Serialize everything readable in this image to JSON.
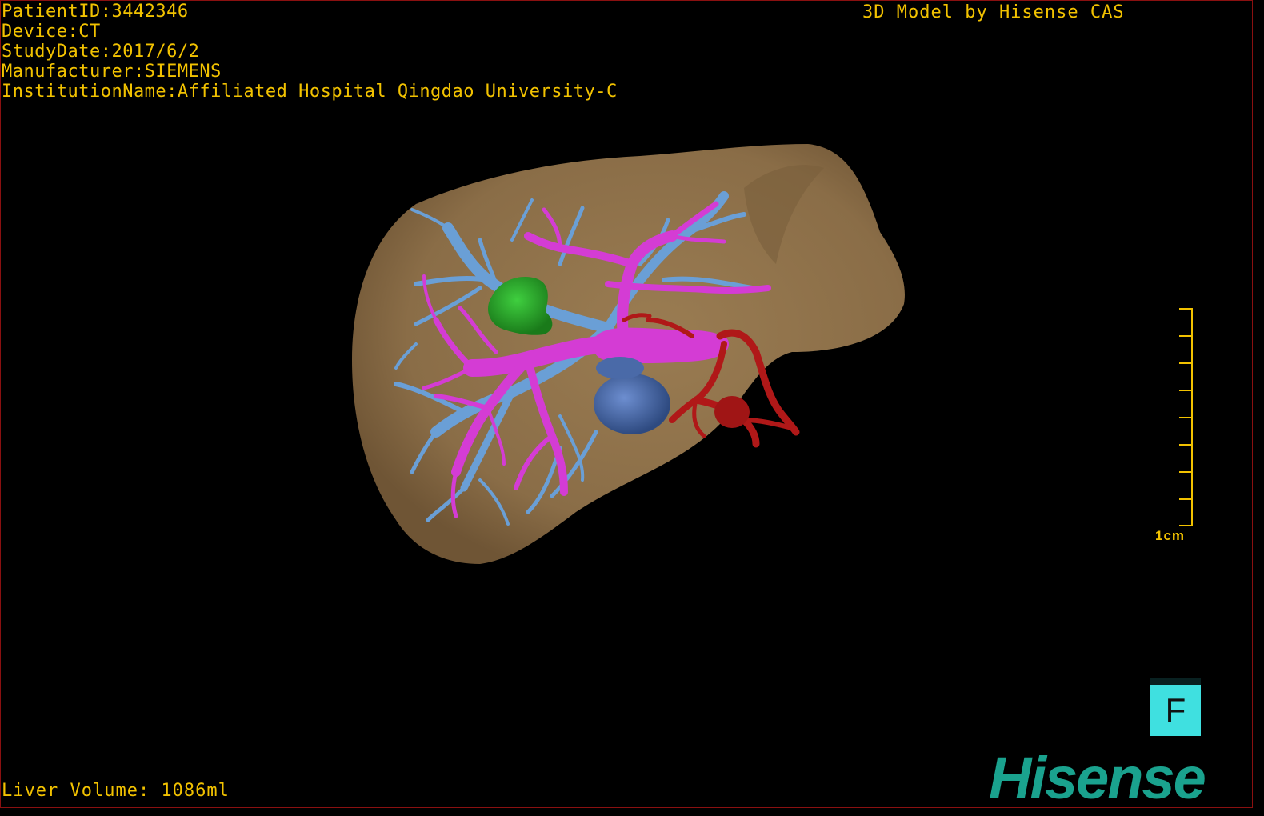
{
  "header": {
    "patient_id": "PatientID:3442346",
    "device": "Device:CT",
    "study_date": "StudyDate:2017/6/2",
    "manufacturer": "Manufacturer:SIEMENS",
    "institution": "InstitutionName:Affiliated Hospital Qingdao University-C"
  },
  "credit": "3D Model by Hisense CAS",
  "footer": {
    "liver_volume": "Liver Volume: 1086ml"
  },
  "scale_bar": {
    "label": "1cm"
  },
  "orientation_button": {
    "label": "F"
  },
  "logo": {
    "text": "Hisense"
  },
  "colors": {
    "text": "#f2c200",
    "liver": "#8c7049",
    "hepatic_vein": "#6a9fd6",
    "portal_vein": "#d43cd4",
    "tumor": "#2fa52f",
    "artery": "#b01818",
    "gallbladder": "#4a6aa8",
    "orientation_button": "#3fe0e0",
    "logo": "#1aa28e"
  }
}
